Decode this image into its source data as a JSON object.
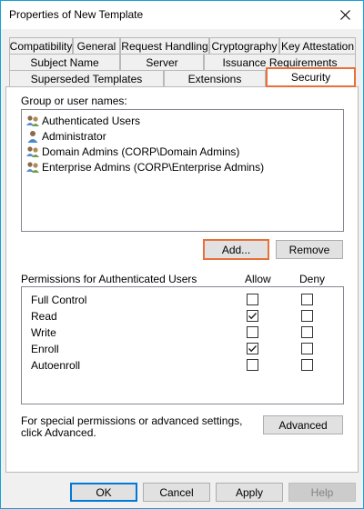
{
  "window": {
    "title": "Properties of New Template"
  },
  "tabs": {
    "row1": [
      {
        "label": "Compatibility"
      },
      {
        "label": "General"
      },
      {
        "label": "Request Handling"
      },
      {
        "label": "Cryptography"
      },
      {
        "label": "Key Attestation"
      }
    ],
    "row2": [
      {
        "label": "Subject Name"
      },
      {
        "label": "Server"
      },
      {
        "label": "Issuance Requirements"
      }
    ],
    "row3": [
      {
        "label": "Superseded Templates"
      },
      {
        "label": "Extensions"
      },
      {
        "label": "Security",
        "selected": true
      }
    ]
  },
  "security": {
    "groups_label": "Group or user names:",
    "groups": [
      {
        "name": "Authenticated Users",
        "icon": "group-icon"
      },
      {
        "name": "Administrator",
        "icon": "user-icon"
      },
      {
        "name": "Domain Admins (CORP\\Domain Admins)",
        "icon": "group-icon"
      },
      {
        "name": "Enterprise Admins (CORP\\Enterprise Admins)",
        "icon": "group-icon"
      }
    ],
    "add_label": "Add...",
    "remove_label": "Remove",
    "permissions_label": "Permissions for Authenticated Users",
    "allow_label": "Allow",
    "deny_label": "Deny",
    "permissions": [
      {
        "name": "Full Control",
        "allow": false,
        "deny": false
      },
      {
        "name": "Read",
        "allow": true,
        "deny": false
      },
      {
        "name": "Write",
        "allow": false,
        "deny": false
      },
      {
        "name": "Enroll",
        "allow": true,
        "deny": false
      },
      {
        "name": "Autoenroll",
        "allow": false,
        "deny": false
      }
    ],
    "advanced_note": "For special permissions or advanced settings, click Advanced.",
    "advanced_label": "Advanced"
  },
  "footer": {
    "ok_label": "OK",
    "cancel_label": "Cancel",
    "apply_label": "Apply",
    "help_label": "Help"
  },
  "colors": {
    "highlight": "#e8703a",
    "window_border": "#18a0d8"
  }
}
